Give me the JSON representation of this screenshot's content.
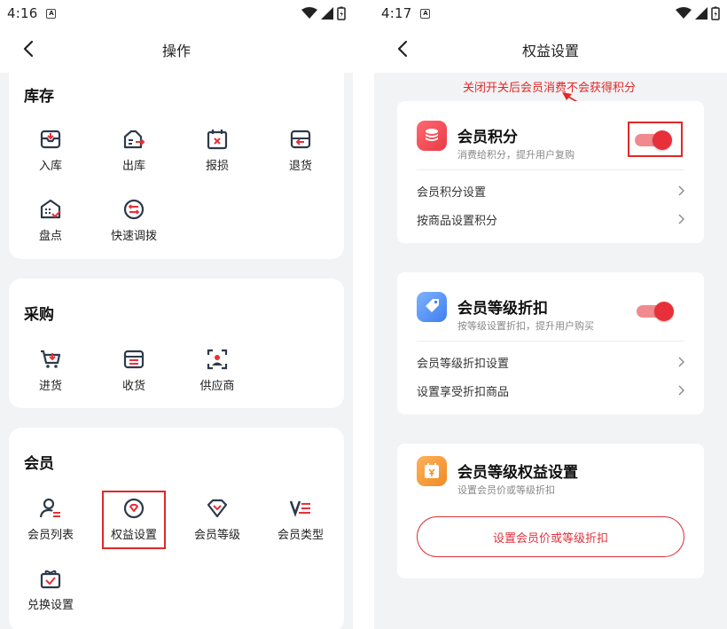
{
  "left": {
    "status": {
      "time": "4:16",
      "badge": "A"
    },
    "nav": {
      "title": "操作"
    },
    "sections": [
      {
        "heading": "库存",
        "items": [
          {
            "label": "入库",
            "icon": "inbox-in-icon"
          },
          {
            "label": "出库",
            "icon": "inbox-out-icon"
          },
          {
            "label": "报损",
            "icon": "calendar-x-icon"
          },
          {
            "label": "退货",
            "icon": "return-icon"
          },
          {
            "label": "盘点",
            "icon": "inventory-check-icon"
          },
          {
            "label": "快速调拨",
            "icon": "transfer-icon"
          }
        ]
      },
      {
        "heading": "采购",
        "items": [
          {
            "label": "进货",
            "icon": "cart-in-icon"
          },
          {
            "label": "收货",
            "icon": "receive-icon"
          },
          {
            "label": "供应商",
            "icon": "supplier-icon"
          }
        ]
      },
      {
        "heading": "会员",
        "items": [
          {
            "label": "会员列表",
            "icon": "member-list-icon"
          },
          {
            "label": "权益设置",
            "icon": "diamond-badge-icon"
          },
          {
            "label": "会员等级",
            "icon": "diamond-icon"
          },
          {
            "label": "会员类型",
            "icon": "member-type-icon"
          },
          {
            "label": "兑换设置",
            "icon": "gift-check-icon"
          }
        ]
      }
    ]
  },
  "right": {
    "status": {
      "time": "4:17",
      "badge": "A"
    },
    "nav": {
      "title": "权益设置"
    },
    "annotation": "关闭开关后会员消费不会获得积分",
    "cards": [
      {
        "title": "会员积分",
        "subtitle": "消费给积分，提升用户复购",
        "icon": "coins-icon",
        "toggle_on": true,
        "rows": [
          "会员积分设置",
          "按商品设置积分"
        ]
      },
      {
        "title": "会员等级折扣",
        "subtitle": "按等级设置折扣，提升用户购买",
        "icon": "tag-icon",
        "toggle_on": true,
        "rows": [
          "会员等级折扣设置",
          "设置享受折扣商品"
        ]
      },
      {
        "title": "会员等级权益设置",
        "subtitle": "设置会员价或等级折扣",
        "icon": "yuan-calendar-icon",
        "button": "设置会员价或等级折扣"
      }
    ]
  },
  "colors": {
    "accent": "#e8303a",
    "icon_dark": "#2d3a4a",
    "annotation": "#e02828"
  }
}
